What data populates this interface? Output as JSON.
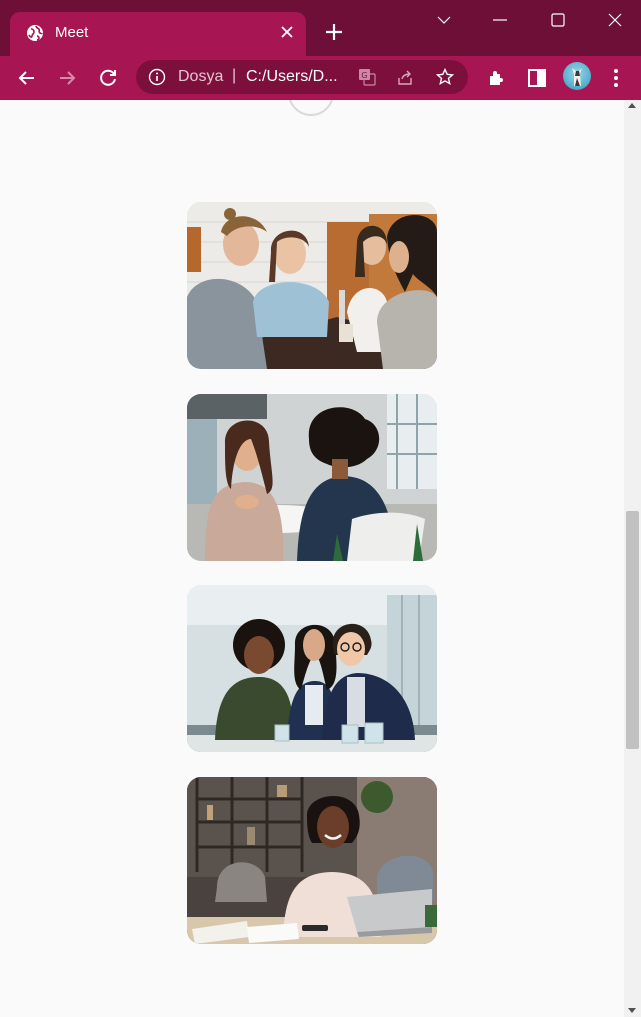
{
  "browser": {
    "tab": {
      "title": "Meet",
      "favicon": "globe-icon"
    },
    "window_controls": [
      "chevron-down-icon",
      "minimize-icon",
      "maximize-icon",
      "close-icon"
    ],
    "omnibox": {
      "site_label": "Dosya",
      "separator": "|",
      "path": "C:/Users/D..."
    },
    "toolbar_icons": [
      "back-icon",
      "forward-icon",
      "reload-icon",
      "translate-icon",
      "share-icon",
      "star-icon",
      "extensions-icon",
      "side-panel-icon",
      "profile-avatar",
      "more-icon"
    ],
    "accent_color": "#a81553",
    "titlebar_color": "#6e0f38"
  },
  "page": {
    "background": "#fafafa",
    "photos": [
      {
        "name": "four-colleagues-at-table-photo"
      },
      {
        "name": "two-women-meeting-photo"
      },
      {
        "name": "three-women-office-photo"
      },
      {
        "name": "woman-with-laptop-photo"
      }
    ]
  }
}
